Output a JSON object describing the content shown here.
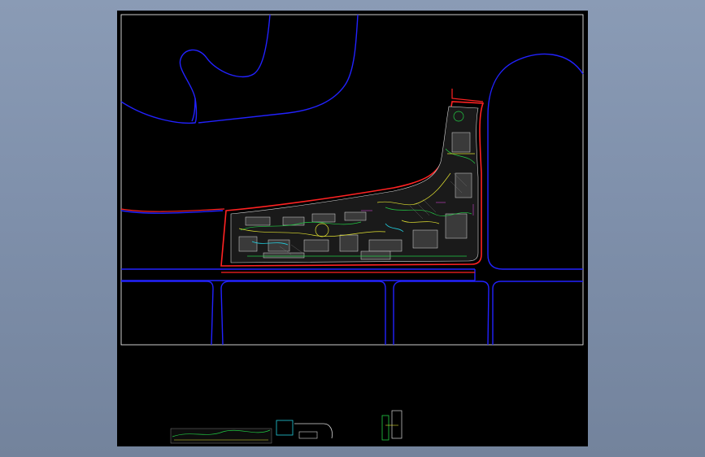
{
  "app": {
    "background": "#8a9bb5"
  },
  "viewport": {
    "background": "#000000"
  },
  "drawing": {
    "colors": {
      "frame": "#ffffff",
      "roads": "#2222ff",
      "site_boundary": "#ff2222",
      "site_detail": "#d8d8d8",
      "landscape": "#22cc44",
      "paths": "#e0e030",
      "water": "#22ccdd",
      "buildings": "#cc44cc"
    },
    "elements": [
      "drawing-frame",
      "road-network",
      "site-boundary",
      "site-plan-detail",
      "detail-thumbnail-strip",
      "detail-thumbnail-small"
    ]
  }
}
